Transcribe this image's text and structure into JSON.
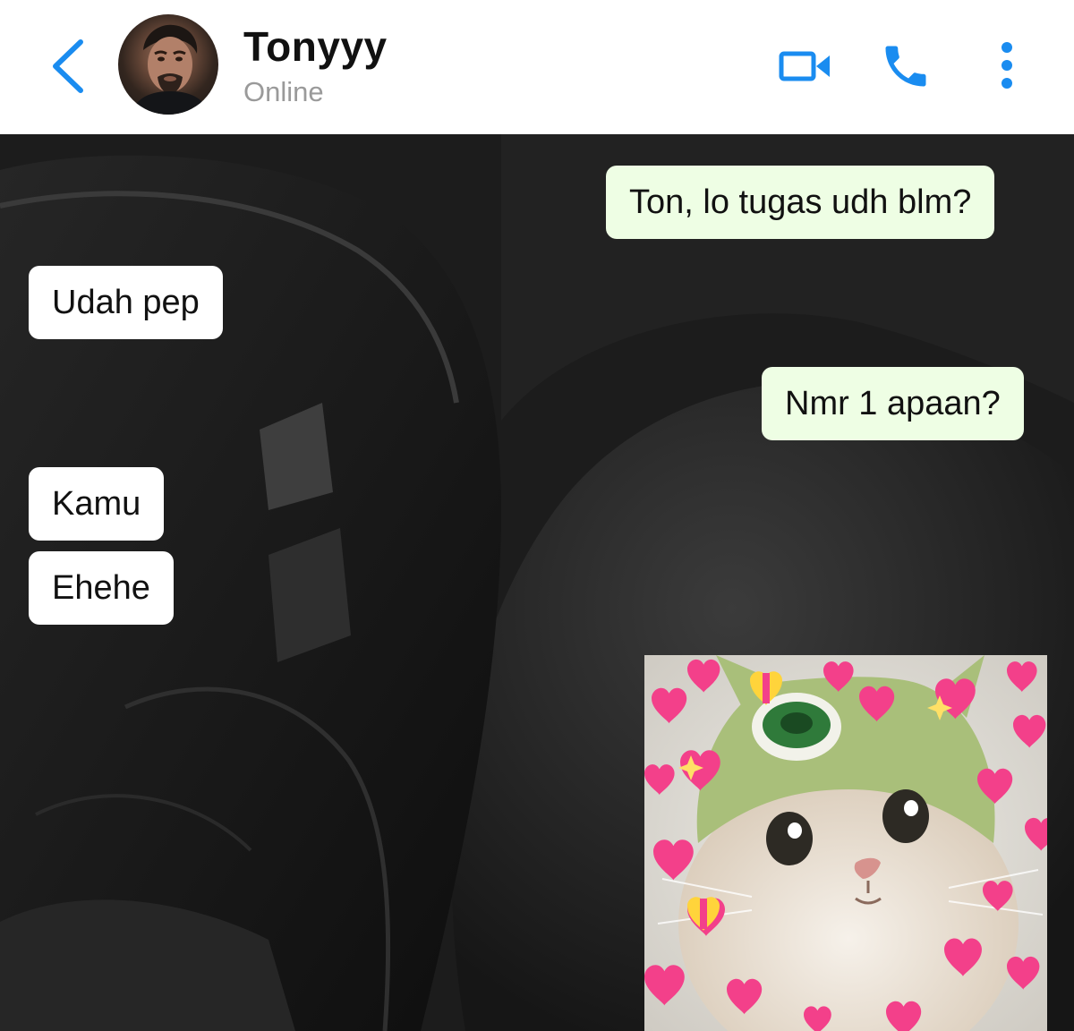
{
  "header": {
    "contact_name": "Tonyyy",
    "status": "Online",
    "accent_color": "#1a8cf0",
    "icons": {
      "back": "chevron-left-icon",
      "video": "video-camera-icon",
      "call": "phone-icon",
      "more": "more-vertical-icon"
    }
  },
  "chat": {
    "messages": [
      {
        "direction": "outgoing",
        "text": "Ton, lo tugas udh blm?"
      },
      {
        "direction": "incoming",
        "text": "Udah pep"
      },
      {
        "direction": "outgoing",
        "text": "Nmr 1 apaan?"
      },
      {
        "direction": "incoming",
        "text": "Kamu"
      },
      {
        "direction": "incoming",
        "text": "Ehehe"
      },
      {
        "direction": "outgoing",
        "type": "sticker",
        "sticker": "cat-in-green-hat-with-hearts"
      }
    ],
    "colors": {
      "outgoing_bubble": "#eefee4",
      "incoming_bubble": "#ffffff",
      "text": "#111111",
      "heart": "#f3408a"
    }
  }
}
